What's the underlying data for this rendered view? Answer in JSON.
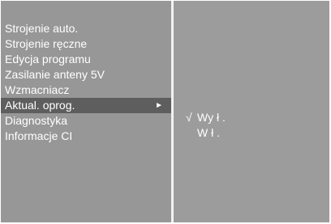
{
  "menu": {
    "items": [
      {
        "label": "Strojenie auto."
      },
      {
        "label": "Strojenie ręczne"
      },
      {
        "label": "Edycja programu"
      },
      {
        "label": "Zasilanie anteny 5V"
      },
      {
        "label": "Wzmacniacz"
      },
      {
        "label": "Aktual. oprog."
      },
      {
        "label": "Diagnostyka"
      },
      {
        "label": "Informacje CI"
      }
    ],
    "selected_index": 5,
    "arrow": "►"
  },
  "submenu": {
    "check_mark": "√",
    "options": [
      {
        "label": "Wy ł .",
        "checked": true
      },
      {
        "label": "W ł .",
        "checked": false
      }
    ]
  },
  "colors": {
    "panel_bg": "#979797",
    "highlight_bg": "#5e5e5e",
    "divider": "#f2f2f2",
    "text": "#ffffff"
  }
}
